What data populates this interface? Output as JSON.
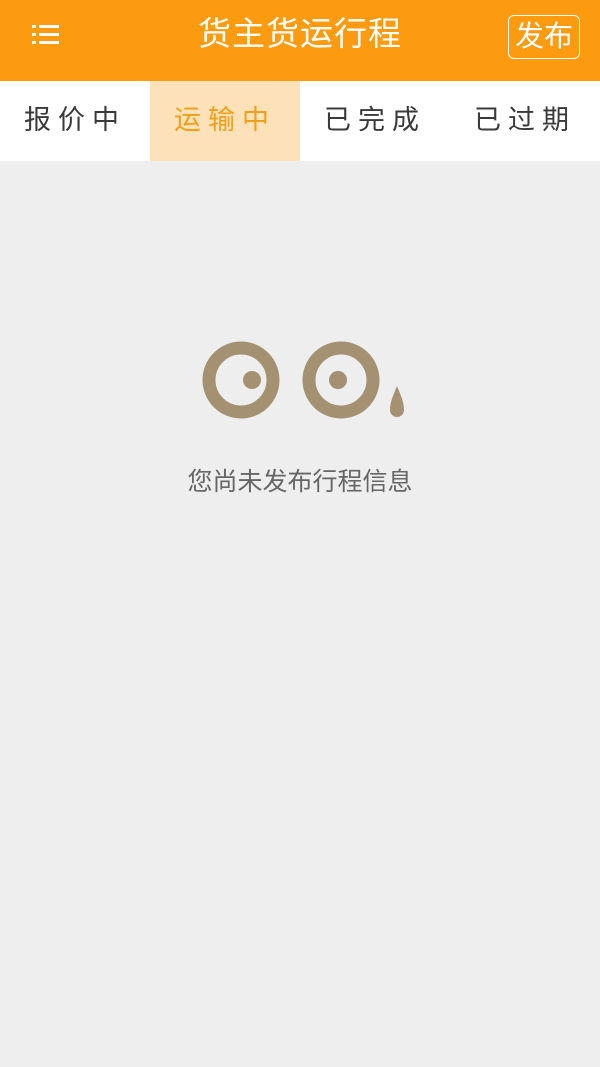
{
  "header": {
    "title": "货主货运行程",
    "menu_icon": "list-menu-icon",
    "publish_label": "发布"
  },
  "tabs": [
    {
      "label": "报价中",
      "active": false
    },
    {
      "label": "运输中",
      "active": true
    },
    {
      "label": "已完成",
      "active": false
    },
    {
      "label": "已过期",
      "active": false
    }
  ],
  "empty_state": {
    "icon": "crying-eyes-icon",
    "message": "您尚未发布行程信息"
  },
  "colors": {
    "header_bg": "#fc9b10",
    "active_tab_bg": "#fde2b9",
    "active_tab_text": "#f0a018",
    "page_bg": "#eeeeee",
    "icon_color": "#a39172"
  }
}
